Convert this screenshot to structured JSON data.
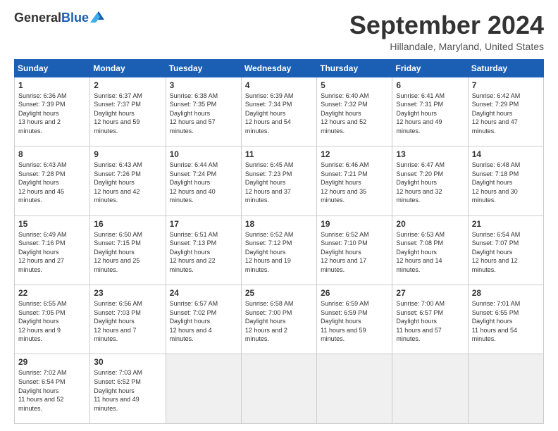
{
  "logo": {
    "general": "General",
    "blue": "Blue"
  },
  "header": {
    "month": "September 2024",
    "location": "Hillandale, Maryland, United States"
  },
  "weekdays": [
    "Sunday",
    "Monday",
    "Tuesday",
    "Wednesday",
    "Thursday",
    "Friday",
    "Saturday"
  ],
  "weeks": [
    [
      {
        "day": 1,
        "sunrise": "6:36 AM",
        "sunset": "7:39 PM",
        "daylight": "13 hours and 2 minutes."
      },
      {
        "day": 2,
        "sunrise": "6:37 AM",
        "sunset": "7:37 PM",
        "daylight": "12 hours and 59 minutes."
      },
      {
        "day": 3,
        "sunrise": "6:38 AM",
        "sunset": "7:35 PM",
        "daylight": "12 hours and 57 minutes."
      },
      {
        "day": 4,
        "sunrise": "6:39 AM",
        "sunset": "7:34 PM",
        "daylight": "12 hours and 54 minutes."
      },
      {
        "day": 5,
        "sunrise": "6:40 AM",
        "sunset": "7:32 PM",
        "daylight": "12 hours and 52 minutes."
      },
      {
        "day": 6,
        "sunrise": "6:41 AM",
        "sunset": "7:31 PM",
        "daylight": "12 hours and 49 minutes."
      },
      {
        "day": 7,
        "sunrise": "6:42 AM",
        "sunset": "7:29 PM",
        "daylight": "12 hours and 47 minutes."
      }
    ],
    [
      {
        "day": 8,
        "sunrise": "6:43 AM",
        "sunset": "7:28 PM",
        "daylight": "12 hours and 45 minutes."
      },
      {
        "day": 9,
        "sunrise": "6:43 AM",
        "sunset": "7:26 PM",
        "daylight": "12 hours and 42 minutes."
      },
      {
        "day": 10,
        "sunrise": "6:44 AM",
        "sunset": "7:24 PM",
        "daylight": "12 hours and 40 minutes."
      },
      {
        "day": 11,
        "sunrise": "6:45 AM",
        "sunset": "7:23 PM",
        "daylight": "12 hours and 37 minutes."
      },
      {
        "day": 12,
        "sunrise": "6:46 AM",
        "sunset": "7:21 PM",
        "daylight": "12 hours and 35 minutes."
      },
      {
        "day": 13,
        "sunrise": "6:47 AM",
        "sunset": "7:20 PM",
        "daylight": "12 hours and 32 minutes."
      },
      {
        "day": 14,
        "sunrise": "6:48 AM",
        "sunset": "7:18 PM",
        "daylight": "12 hours and 30 minutes."
      }
    ],
    [
      {
        "day": 15,
        "sunrise": "6:49 AM",
        "sunset": "7:16 PM",
        "daylight": "12 hours and 27 minutes."
      },
      {
        "day": 16,
        "sunrise": "6:50 AM",
        "sunset": "7:15 PM",
        "daylight": "12 hours and 25 minutes."
      },
      {
        "day": 17,
        "sunrise": "6:51 AM",
        "sunset": "7:13 PM",
        "daylight": "12 hours and 22 minutes."
      },
      {
        "day": 18,
        "sunrise": "6:52 AM",
        "sunset": "7:12 PM",
        "daylight": "12 hours and 19 minutes."
      },
      {
        "day": 19,
        "sunrise": "6:52 AM",
        "sunset": "7:10 PM",
        "daylight": "12 hours and 17 minutes."
      },
      {
        "day": 20,
        "sunrise": "6:53 AM",
        "sunset": "7:08 PM",
        "daylight": "12 hours and 14 minutes."
      },
      {
        "day": 21,
        "sunrise": "6:54 AM",
        "sunset": "7:07 PM",
        "daylight": "12 hours and 12 minutes."
      }
    ],
    [
      {
        "day": 22,
        "sunrise": "6:55 AM",
        "sunset": "7:05 PM",
        "daylight": "12 hours and 9 minutes."
      },
      {
        "day": 23,
        "sunrise": "6:56 AM",
        "sunset": "7:03 PM",
        "daylight": "12 hours and 7 minutes."
      },
      {
        "day": 24,
        "sunrise": "6:57 AM",
        "sunset": "7:02 PM",
        "daylight": "12 hours and 4 minutes."
      },
      {
        "day": 25,
        "sunrise": "6:58 AM",
        "sunset": "7:00 PM",
        "daylight": "12 hours and 2 minutes."
      },
      {
        "day": 26,
        "sunrise": "6:59 AM",
        "sunset": "6:59 PM",
        "daylight": "11 hours and 59 minutes."
      },
      {
        "day": 27,
        "sunrise": "7:00 AM",
        "sunset": "6:57 PM",
        "daylight": "11 hours and 57 minutes."
      },
      {
        "day": 28,
        "sunrise": "7:01 AM",
        "sunset": "6:55 PM",
        "daylight": "11 hours and 54 minutes."
      }
    ],
    [
      {
        "day": 29,
        "sunrise": "7:02 AM",
        "sunset": "6:54 PM",
        "daylight": "11 hours and 52 minutes."
      },
      {
        "day": 30,
        "sunrise": "7:03 AM",
        "sunset": "6:52 PM",
        "daylight": "11 hours and 49 minutes."
      },
      null,
      null,
      null,
      null,
      null
    ]
  ]
}
